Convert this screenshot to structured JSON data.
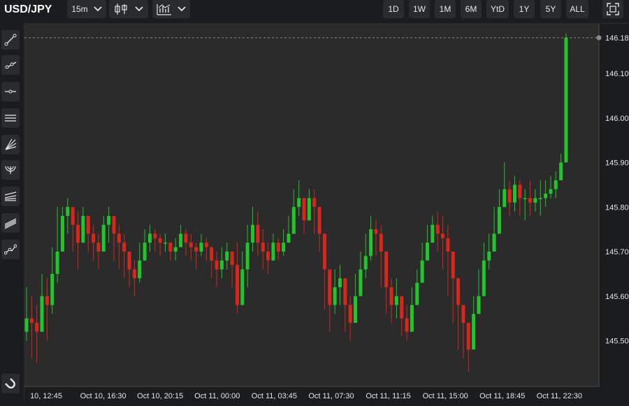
{
  "toolbar": {
    "symbol": "USD/JPY",
    "interval": "15m",
    "ranges": [
      "1D",
      "1W",
      "1M",
      "6M",
      "YtD",
      "1Y",
      "5Y",
      "ALL"
    ]
  },
  "icons": {
    "interval_dropdown": "chevron-down-icon",
    "chart_type": "candlestick-icon",
    "indicators": "indicators-icon",
    "fullscreen": "fullscreen-icon",
    "tools": [
      "trend-line-icon",
      "ray-icon",
      "horizontal-line-icon",
      "parallel-channel-icon",
      "fan-icon",
      "arc-icon",
      "pitchfork-icon",
      "channel-icon",
      "path-icon",
      "magnet-icon"
    ]
  },
  "colors": {
    "up": "#21c42a",
    "down": "#d9261c",
    "background": "#2a2b2a",
    "last_price_dot": "#8a8a8a"
  },
  "chart_data": {
    "type": "candlestick",
    "title": "USD/JPY",
    "interval": "15m",
    "last_price": "146.18",
    "y_ticks": [
      "146.18",
      "146.10",
      "146.00",
      "145.90",
      "145.80",
      "145.70",
      "145.60",
      "145.50"
    ],
    "x_ticks": [
      "10, 12:45",
      "Oct 10, 16:30",
      "Oct 10, 20:15",
      "Oct 11, 00:00",
      "Oct 11, 03:45",
      "Oct 11, 07:30",
      "Oct 11, 11:15",
      "Oct 11, 15:00",
      "Oct 11, 18:45",
      "Oct 11, 22:30"
    ],
    "ylim": [
      145.41,
      146.2
    ],
    "grid": false,
    "closes": [
      145.55,
      145.54,
      145.52,
      145.6,
      145.58,
      145.65,
      145.7,
      145.78,
      145.8,
      145.76,
      145.72,
      145.78,
      145.74,
      145.72,
      145.7,
      145.76,
      145.78,
      145.74,
      145.72,
      145.7,
      145.66,
      145.64,
      145.68,
      145.72,
      145.74,
      145.73,
      145.72,
      145.72,
      145.7,
      145.71,
      145.74,
      145.72,
      145.71,
      145.7,
      145.72,
      145.71,
      145.68,
      145.66,
      145.68,
      145.7,
      145.67,
      145.58,
      145.66,
      145.72,
      145.76,
      145.72,
      145.7,
      145.68,
      145.72,
      145.7,
      145.72,
      145.74,
      145.8,
      145.82,
      145.77,
      145.82,
      145.8,
      145.74,
      145.66,
      145.58,
      145.62,
      145.64,
      145.58,
      145.54,
      145.6,
      145.66,
      145.69,
      145.75,
      145.74,
      145.7,
      145.62,
      145.58,
      145.6,
      145.55,
      145.52,
      145.58,
      145.63,
      145.68,
      145.72,
      145.76,
      145.74,
      145.73,
      145.7,
      145.64,
      145.58,
      145.54,
      145.48,
      145.56,
      145.6,
      145.68,
      145.7,
      145.74,
      145.8,
      145.84,
      145.81,
      145.85,
      145.82,
      145.82,
      145.81,
      145.82,
      145.82,
      145.83,
      145.84,
      145.86,
      145.9,
      146.18
    ],
    "highs": [
      145.62,
      145.6,
      145.58,
      145.65,
      145.64,
      145.71,
      145.8,
      145.8,
      145.82,
      145.8,
      145.79,
      145.8,
      145.78,
      145.76,
      145.74,
      145.78,
      145.8,
      145.78,
      145.76,
      145.74,
      145.7,
      145.68,
      145.72,
      145.75,
      145.76,
      145.75,
      145.74,
      145.74,
      145.72,
      145.73,
      145.76,
      145.75,
      145.74,
      145.72,
      145.74,
      145.73,
      145.71,
      145.7,
      145.71,
      145.72,
      145.7,
      145.72,
      145.7,
      145.76,
      145.8,
      145.79,
      145.75,
      145.72,
      145.74,
      145.73,
      145.75,
      145.78,
      145.84,
      145.86,
      145.82,
      145.84,
      145.84,
      145.8,
      145.72,
      145.66,
      145.66,
      145.67,
      145.64,
      145.6,
      145.65,
      145.7,
      145.74,
      145.78,
      145.77,
      145.76,
      145.68,
      145.64,
      145.64,
      145.6,
      145.58,
      145.62,
      145.66,
      145.72,
      145.76,
      145.78,
      145.79,
      145.78,
      145.76,
      145.7,
      145.64,
      145.58,
      145.54,
      145.6,
      145.66,
      145.72,
      145.74,
      145.8,
      145.84,
      145.9,
      145.86,
      145.87,
      145.86,
      145.84,
      145.86,
      145.84,
      145.86,
      145.86,
      145.87,
      145.88,
      145.92,
      146.19
    ],
    "lows": [
      145.5,
      145.46,
      145.45,
      145.52,
      145.5,
      145.56,
      145.63,
      145.72,
      145.74,
      145.7,
      145.66,
      145.72,
      145.7,
      145.68,
      145.66,
      145.7,
      145.72,
      145.68,
      145.66,
      145.64,
      145.62,
      145.6,
      145.63,
      145.68,
      145.7,
      145.7,
      145.69,
      145.7,
      145.68,
      145.68,
      145.71,
      145.69,
      145.68,
      145.66,
      145.69,
      145.68,
      145.64,
      145.62,
      145.64,
      145.66,
      145.62,
      145.56,
      145.58,
      145.62,
      145.7,
      145.69,
      145.66,
      145.65,
      145.68,
      145.68,
      145.69,
      145.72,
      145.76,
      145.78,
      145.74,
      145.78,
      145.74,
      145.7,
      145.57,
      145.52,
      145.56,
      145.58,
      145.52,
      145.5,
      145.54,
      145.6,
      145.64,
      145.68,
      145.69,
      145.62,
      145.56,
      145.54,
      145.55,
      145.51,
      145.5,
      145.54,
      145.58,
      145.64,
      145.68,
      145.72,
      145.7,
      145.66,
      145.6,
      145.54,
      145.48,
      145.46,
      145.43,
      145.5,
      145.56,
      145.62,
      145.66,
      145.7,
      145.76,
      145.8,
      145.78,
      145.79,
      145.78,
      145.77,
      145.78,
      145.79,
      145.78,
      145.8,
      145.82,
      145.82,
      145.86,
      145.9
    ]
  }
}
